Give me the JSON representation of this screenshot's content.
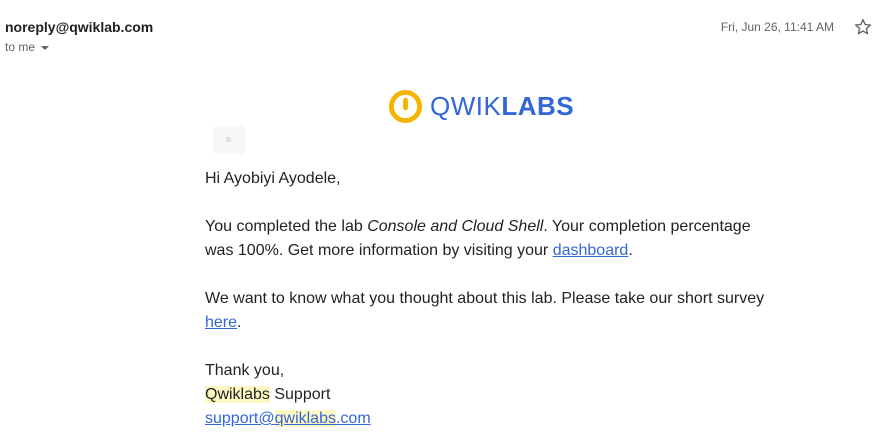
{
  "header": {
    "sender": "noreply@qwiklab.com",
    "recipient_label": "to me",
    "date": "Fri, Jun 26, 11:41 AM"
  },
  "logo": {
    "brand_light": "QWIK",
    "brand_bold": "LABS",
    "mark_color": "#f4b400",
    "text_color": "#3367d6"
  },
  "body": {
    "greeting": "Hi Ayobiyi Ayodele,",
    "p1_before": "You completed the lab ",
    "p1_lab_name": "Console and Cloud Shell",
    "p1_after": ". Your completion percentage was 100%. Get more information by visiting your ",
    "p1_link": "dashboard",
    "p1_end": ".",
    "p2_before": "We want to know what you thought about this lab. Please take our short survey ",
    "p2_link": "here",
    "p2_end": ".",
    "signoff": "Thank you,",
    "sig_highlight": "Qwiklabs",
    "sig_rest": " Support",
    "email_part1": "support@",
    "email_highlight": "qwiklabs",
    "email_part2": ".com"
  },
  "icons": {
    "star": "star-outline-icon",
    "caret": "caret-down-icon",
    "logo_mark": "qwiklabs-logo-icon"
  },
  "colors": {
    "link": "#3367d6",
    "highlight": "#fdf8c3",
    "meta_text": "#5f6368"
  }
}
